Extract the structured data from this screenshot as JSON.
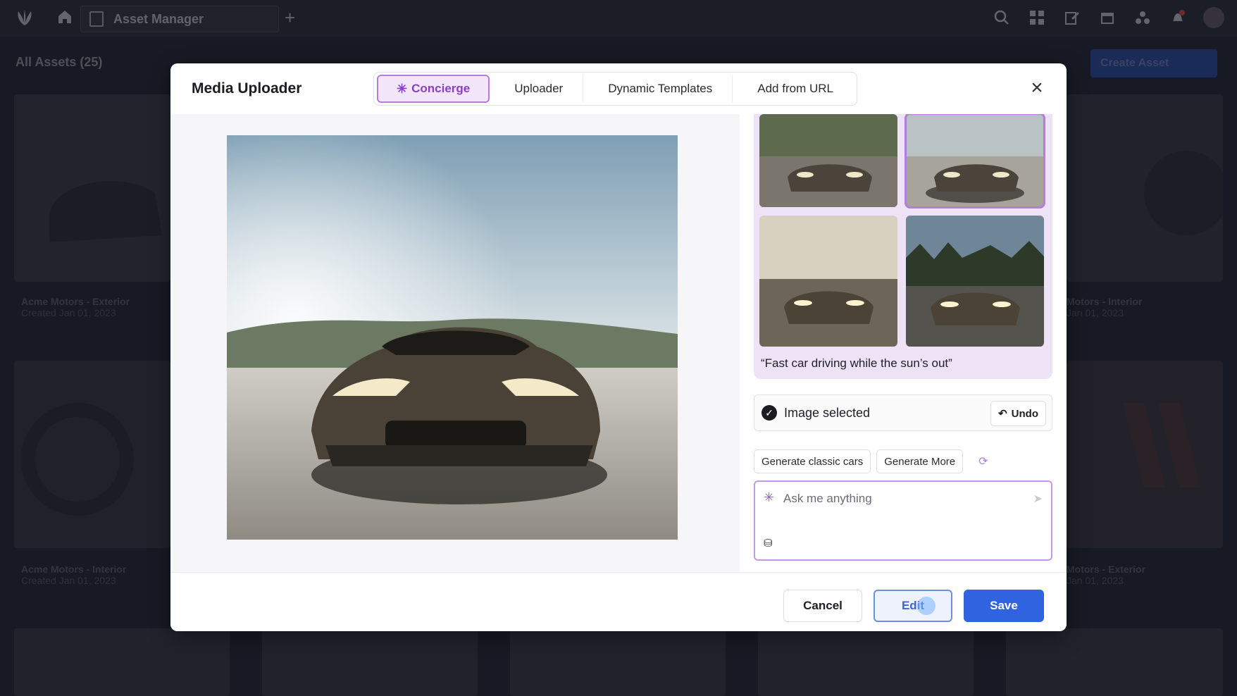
{
  "app": {
    "tab_title": "Asset Manager",
    "filter_label": "All Assets (25)",
    "create_button": "Create Asset",
    "cards": [
      {
        "title": "Acme Motors - Exterior",
        "date": "Created Jan 01, 2023"
      },
      {
        "title": "Acme Motors - Interior",
        "date": "Created Jan 01, 2023"
      },
      {
        "title": "Motors - Interior",
        "date": "Jan 01, 2023"
      },
      {
        "title": "Motors - Exterior",
        "date": "Jan 01, 2023"
      }
    ]
  },
  "modal": {
    "title": "Media Uploader",
    "tabs": [
      {
        "label": "Concierge",
        "active": true
      },
      {
        "label": "Uploader",
        "active": false
      },
      {
        "label": "Dynamic Templates",
        "active": false
      },
      {
        "label": "Add from URL",
        "active": false
      }
    ],
    "prompt": "“Fast car driving while the sun’s out”",
    "selection": {
      "status": "Image selected",
      "undo_label": "Undo"
    },
    "suggestions": [
      "Generate classic cars",
      "Generate More"
    ],
    "ask": {
      "placeholder": "Ask me anything",
      "value": ""
    },
    "footer": {
      "cancel": "Cancel",
      "edit": "Edit",
      "save": "Save"
    }
  },
  "icons": {
    "accent": "#b27ed8",
    "primary": "#2f63df",
    "glyphs": [
      "logo-icon",
      "home-icon",
      "document-icon",
      "plus-icon",
      "search-icon",
      "grid-icon",
      "edit-icon",
      "calendar-icon",
      "network-icon",
      "bell-icon",
      "sparkle-icon",
      "close-icon",
      "check-icon",
      "undo-icon",
      "refresh-icon",
      "send-icon",
      "attach-icon"
    ]
  }
}
